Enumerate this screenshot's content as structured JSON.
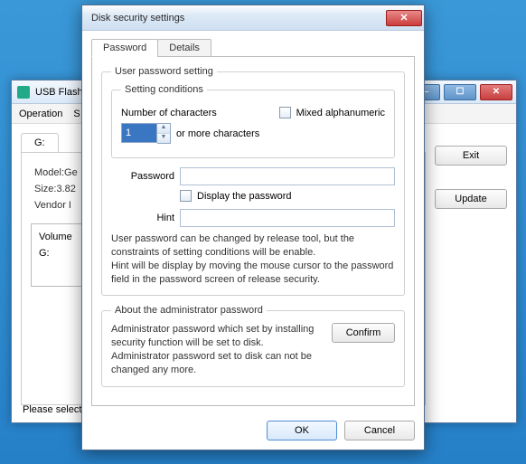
{
  "bg_window": {
    "title": "USB Flash S",
    "menu": {
      "operation": "Operation",
      "more": "S"
    },
    "tab_drive": "G:",
    "info": {
      "model": "Model:Ge",
      "size": "Size:3.82",
      "vendor": "Vendor I"
    },
    "volume_label": "Volume",
    "volume_value": "G:",
    "buttons": {
      "exit": "Exit",
      "update": "Update"
    },
    "status": "Please select a"
  },
  "dialog": {
    "title": "Disk security settings",
    "tabs": {
      "password": "Password",
      "details": "Details"
    },
    "user_password_group": "User password setting",
    "setting_conditions_group": "Setting conditions",
    "num_chars_label": "Number of characters",
    "num_chars_value": "1",
    "or_more": "or more characters",
    "mixed_label": "Mixed alphanumeric",
    "password_label": "Password",
    "password_value": "",
    "display_pw_label": "Display the password",
    "hint_label": "Hint",
    "hint_value": "",
    "note": "User password can be changed by release tool, but the constraints of setting conditions will be enable.\nHint will be display by moving the mouse cursor to the password field in the password screen of release security.",
    "admin_group": "About the administrator password",
    "admin_note": "Administrator password which set by installing security function will be set to disk.\nAdministrator password set to disk can not be changed any more.",
    "confirm": "Confirm",
    "ok": "OK",
    "cancel": "Cancel"
  }
}
